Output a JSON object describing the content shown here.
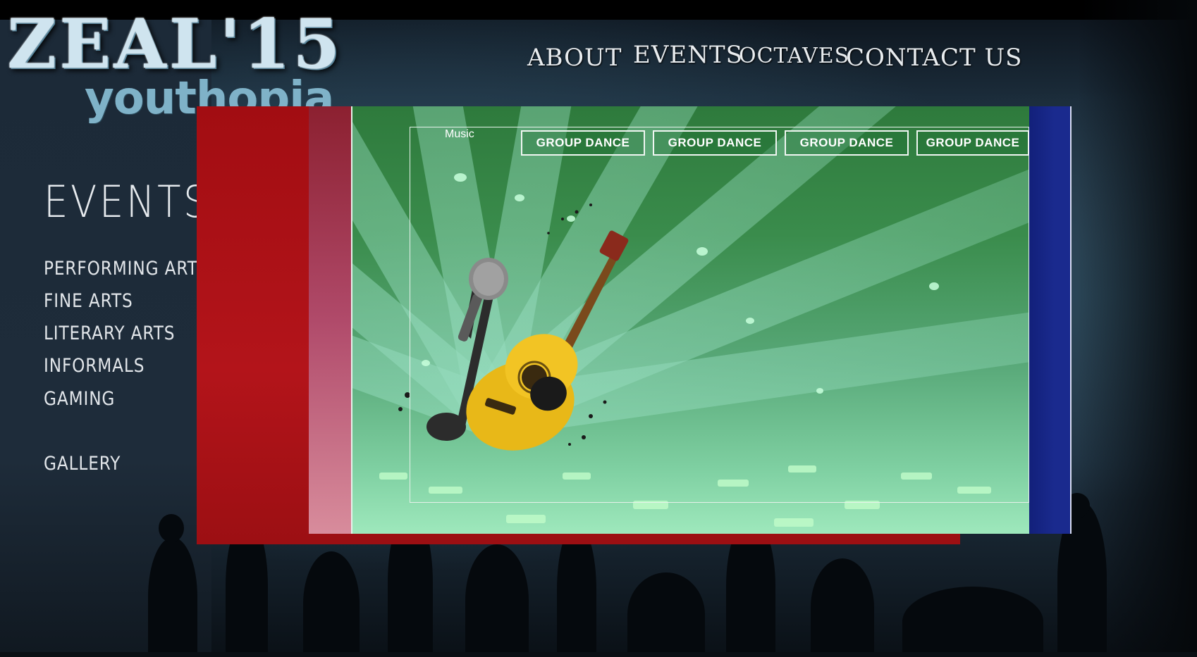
{
  "logo": {
    "main": "ZEAL'15",
    "sub": "youthopia"
  },
  "topnav": [
    "ABOUT",
    "EVENTS",
    "OCTAVES",
    "CONTACT US"
  ],
  "sidebar": {
    "title": "EVENTS",
    "items": [
      "PERFORMING ARTS",
      "FINE ARTS",
      "LITERARY ARTS",
      "INFORMALS",
      "GAMING"
    ],
    "gallery": "GALLERY"
  },
  "panel": {
    "music_label": "Music",
    "tabs": [
      "GROUP DANCE",
      "GROUP DANCE",
      "GROUP DANCE",
      "GROUP DANCE"
    ]
  }
}
